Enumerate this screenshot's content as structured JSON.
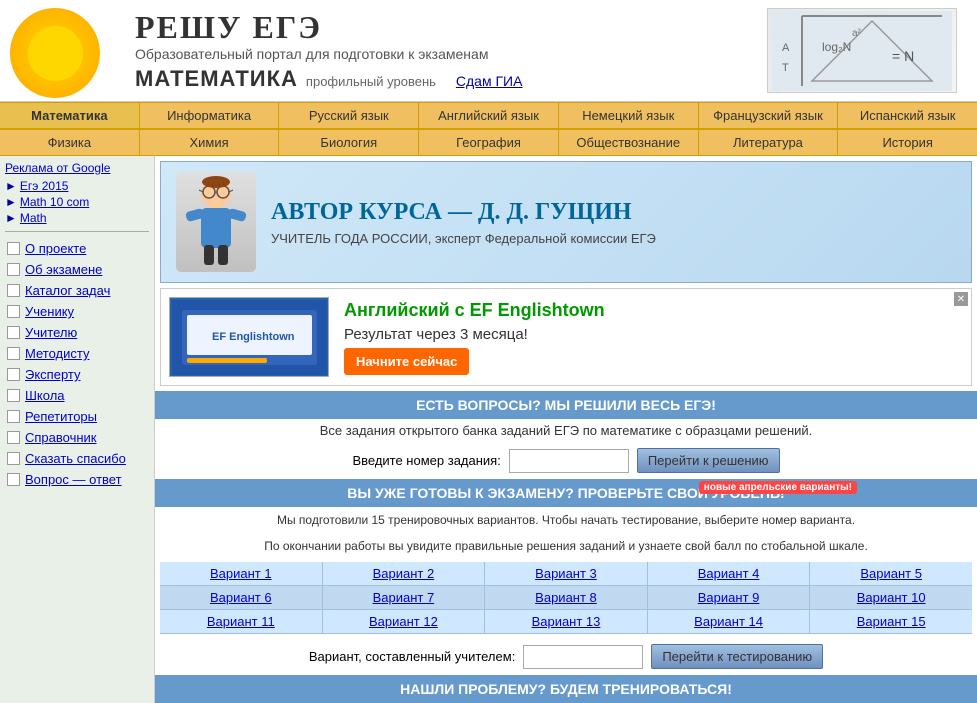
{
  "header": {
    "title": "РЕШУ ЕГЭ",
    "subtitle": "Образовательный портал для подготовки к экзаменам",
    "subject": "МАТЕМАТИКА",
    "level": "профильный уровень",
    "sdam_gia": "Сдам ГИА"
  },
  "nav1": {
    "items": [
      "Математика",
      "Информатика",
      "Русский язык",
      "Английский язык",
      "Немецкий язык",
      "Французский язык",
      "Испанский язык"
    ]
  },
  "nav2": {
    "items": [
      "Физика",
      "Химия",
      "Биология",
      "География",
      "Обществознание",
      "Литература",
      "История"
    ]
  },
  "sidebar": {
    "ads_label": "Реклама от Google",
    "ad_items": [
      {
        "label": "Егэ 2015"
      },
      {
        "label": "Math 10 com"
      },
      {
        "label": "Math"
      }
    ],
    "nav_items": [
      "О проекте",
      "Об экзамене",
      "Каталог задач",
      "Ученику",
      "Учителю",
      "Методисту",
      "Эксперту",
      "Школа",
      "Репетиторы",
      "Справочник",
      "Сказать спасибо",
      "Вопрос — ответ"
    ]
  },
  "author": {
    "title": "АВТОР КУРСА — Д. Д. ГУЩИН",
    "subtitle": "УЧИТЕЛЬ ГОДА РОССИИ, эксперт Федеральной комиссии ЕГЭ"
  },
  "ef_banner": {
    "title": "Английский с EF Englishtown",
    "subtitle": "Результат через 3 месяца!",
    "button": "Начните сейчас"
  },
  "section1": {
    "header": "ЕСТЬ ВОПРОСЫ? МЫ РЕШИЛИ ВЕСЬ ЕГЭ!",
    "subtext": "Все задания открытого банка заданий ЕГЭ по математике с образцами решений.",
    "task_label": "Введите номер задания:",
    "task_button": "Перейти к решению",
    "task_input_placeholder": ""
  },
  "section2": {
    "header": "ВЫ УЖЕ ГОТОВЫ К ЭКЗАМЕНУ? ПРОВЕРЬТЕ СВОЙ УРОВЕНЬ!",
    "new_badge": "новые апрельские варианты!",
    "subtext1": "Мы подготовили 15 тренировочных вариантов. Чтобы начать тестирование, выберите номер варианта.",
    "subtext2": "По окончании работы вы увидите правильные решения заданий и узнаете свой балл по стобальной шкале.",
    "variants": [
      [
        "Вариант 1",
        "Вариант 2",
        "Вариант 3",
        "Вариант 4",
        "Вариант 5"
      ],
      [
        "Вариант 6",
        "Вариант 7",
        "Вариант 8",
        "Вариант 9",
        "Вариант 10"
      ],
      [
        "Вариант 11",
        "Вариант 12",
        "Вариант 13",
        "Вариант 14",
        "Вариант 15"
      ]
    ],
    "teacher_label": "Вариант, составленный учителем:",
    "teacher_button": "Перейти к тестированию",
    "teacher_input_placeholder": ""
  },
  "section3": {
    "header": "НАШЛИ ПРОБЛЕМУ? БУДЕМ ТРЕНИРОВАТЬСЯ!"
  }
}
